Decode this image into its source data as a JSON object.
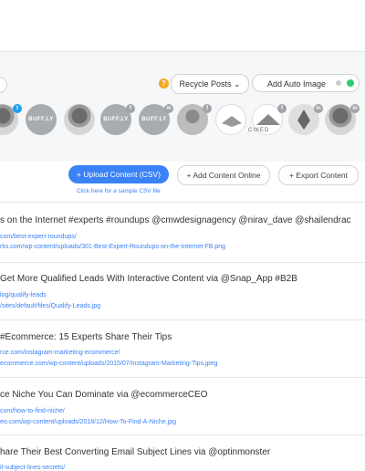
{
  "toolbar": {
    "help_icon": "?",
    "recycle_label": "Recycle Posts ⌄",
    "auto_image_label": "Add Auto Image"
  },
  "profiles": [
    {
      "kind": "photo",
      "badge": "twitter"
    },
    {
      "kind": "buffer",
      "text": "BUFF.LY"
    },
    {
      "kind": "photo"
    },
    {
      "kind": "buffer",
      "text": "BUFF.LY",
      "badge": "facebook"
    },
    {
      "kind": "buffer",
      "text": "BUFF.LY",
      "badge": "linkedin"
    },
    {
      "kind": "ghost",
      "badge": "facebook"
    },
    {
      "kind": "logo",
      "badge": "twitter"
    },
    {
      "kind": "logo",
      "badge": "facebook"
    },
    {
      "kind": "tree",
      "badge": "linkedin"
    },
    {
      "kind": "photo",
      "badge": "linkedin"
    },
    {
      "kind": "photo"
    }
  ],
  "ciked_text": "CIKED",
  "actions": {
    "upload": "+ Upload Content (CSV)",
    "add_online": "+ Add Content Online",
    "export": "+ Export Content",
    "sample": "Click here for a sample CSV file"
  },
  "posts": [
    {
      "title": "s on the Internet #experts #roundups @cmwdesignagency @nirav_dave @shailendrac",
      "url": "com/best-expert-roundups/",
      "image": "rks.com/wp-content/uploads/301-Best-Expert-Roundups-on-the-Internet-FB.png"
    },
    {
      "title": "Get More Qualified Leads With Interactive Content via @Snap_App #B2B",
      "url": "log/qualify-leads",
      "image": "/sites/default/files/Qualify-Leads.jpg"
    },
    {
      "title": "#Ecommerce: 15 Experts Share Their Tips",
      "url": "rce.com/instagram-marketing-ecommerce/",
      "image": "ecommerce.com/wp-content/uploads/2015/07/Instagram-Marketing-Tips.jpeg"
    },
    {
      "title": "ce Niche You Can Dominate via @ecommerceCEO",
      "url": "com/how-to-find-niche/",
      "image": "eo.com/wp-content/uploads/2018/12/How-To-Find-A-Niche.jpg"
    },
    {
      "title": "hare Their Best Converting Email Subject Lines via @optinmonster",
      "url": "il-subject-lines-secrets/",
      "image": ""
    }
  ]
}
